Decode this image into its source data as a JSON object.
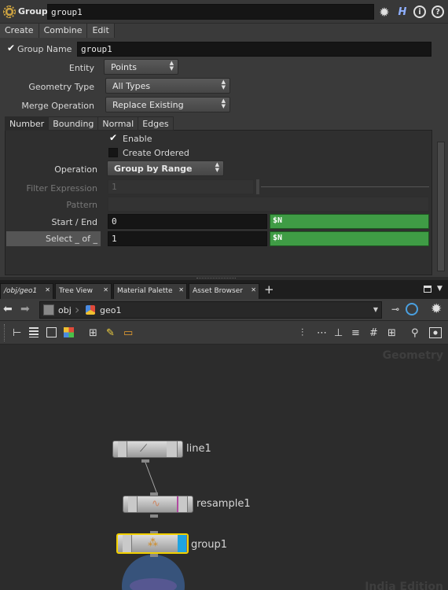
{
  "param_pane": {
    "node_type": "Group",
    "node_name": "group1",
    "toolbar_icons": [
      "gear-icon",
      "help-h-icon",
      "info-icon",
      "question-icon"
    ],
    "menu": [
      "Create",
      "Combine",
      "Edit"
    ],
    "group_name_label": "Group Name",
    "group_name_value": "group1",
    "entity_label": "Entity",
    "entity_value": "Points",
    "geometry_type_label": "Geometry Type",
    "geometry_type_value": "All Types",
    "merge_operation_label": "Merge Operation",
    "merge_operation_value": "Replace Existing",
    "tabs": [
      "Number",
      "Bounding",
      "Normal",
      "Edges"
    ],
    "enable_label": "Enable",
    "create_ordered_label": "Create Ordered",
    "operation_label": "Operation",
    "operation_value": "Group by Range",
    "filter_expression_label": "Filter Expression",
    "filter_expression_value": "1",
    "pattern_label": "Pattern",
    "start_end_label": "Start / End",
    "start_value": "0",
    "end_value": "$N",
    "select_label": "Select _ of _",
    "select_value": "1",
    "select_of_value": "$N"
  },
  "network_pane": {
    "tabs": [
      {
        "label": "/obj/geo1"
      },
      {
        "label": "Tree View"
      },
      {
        "label": "Material Palette"
      },
      {
        "label": "Asset Browser"
      }
    ],
    "add_tab": "+",
    "path": [
      "obj",
      "geo1"
    ],
    "context_label": "Geometry",
    "edition_label": "India Edition",
    "nodes": [
      {
        "name": "line1"
      },
      {
        "name": "resample1"
      },
      {
        "name": "group1"
      }
    ]
  },
  "colors": {
    "expression_green": "#3f9c45",
    "selected_node_border": "#f2d000",
    "display_flag_blue": "#1fa3e0"
  }
}
